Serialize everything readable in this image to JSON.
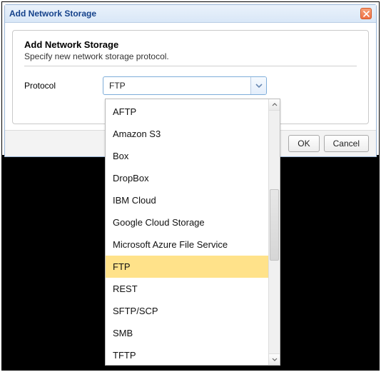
{
  "dialog": {
    "windowTitle": "Add Network Storage",
    "groupTitle": "Add Network Storage",
    "groupSubtitle": "Specify new network storage protocol.",
    "protocolLabel": "Protocol",
    "okLabel": "OK",
    "cancelLabel": "Cancel"
  },
  "protocol": {
    "value": "FTP",
    "selectedIndex": 7,
    "options": [
      "AFTP",
      "Amazon S3",
      "Box",
      "DropBox",
      "IBM Cloud",
      "Google Cloud Storage",
      "Microsoft Azure File Service",
      "FTP",
      "REST",
      "SFTP/SCP",
      "SMB",
      "TFTP"
    ]
  }
}
